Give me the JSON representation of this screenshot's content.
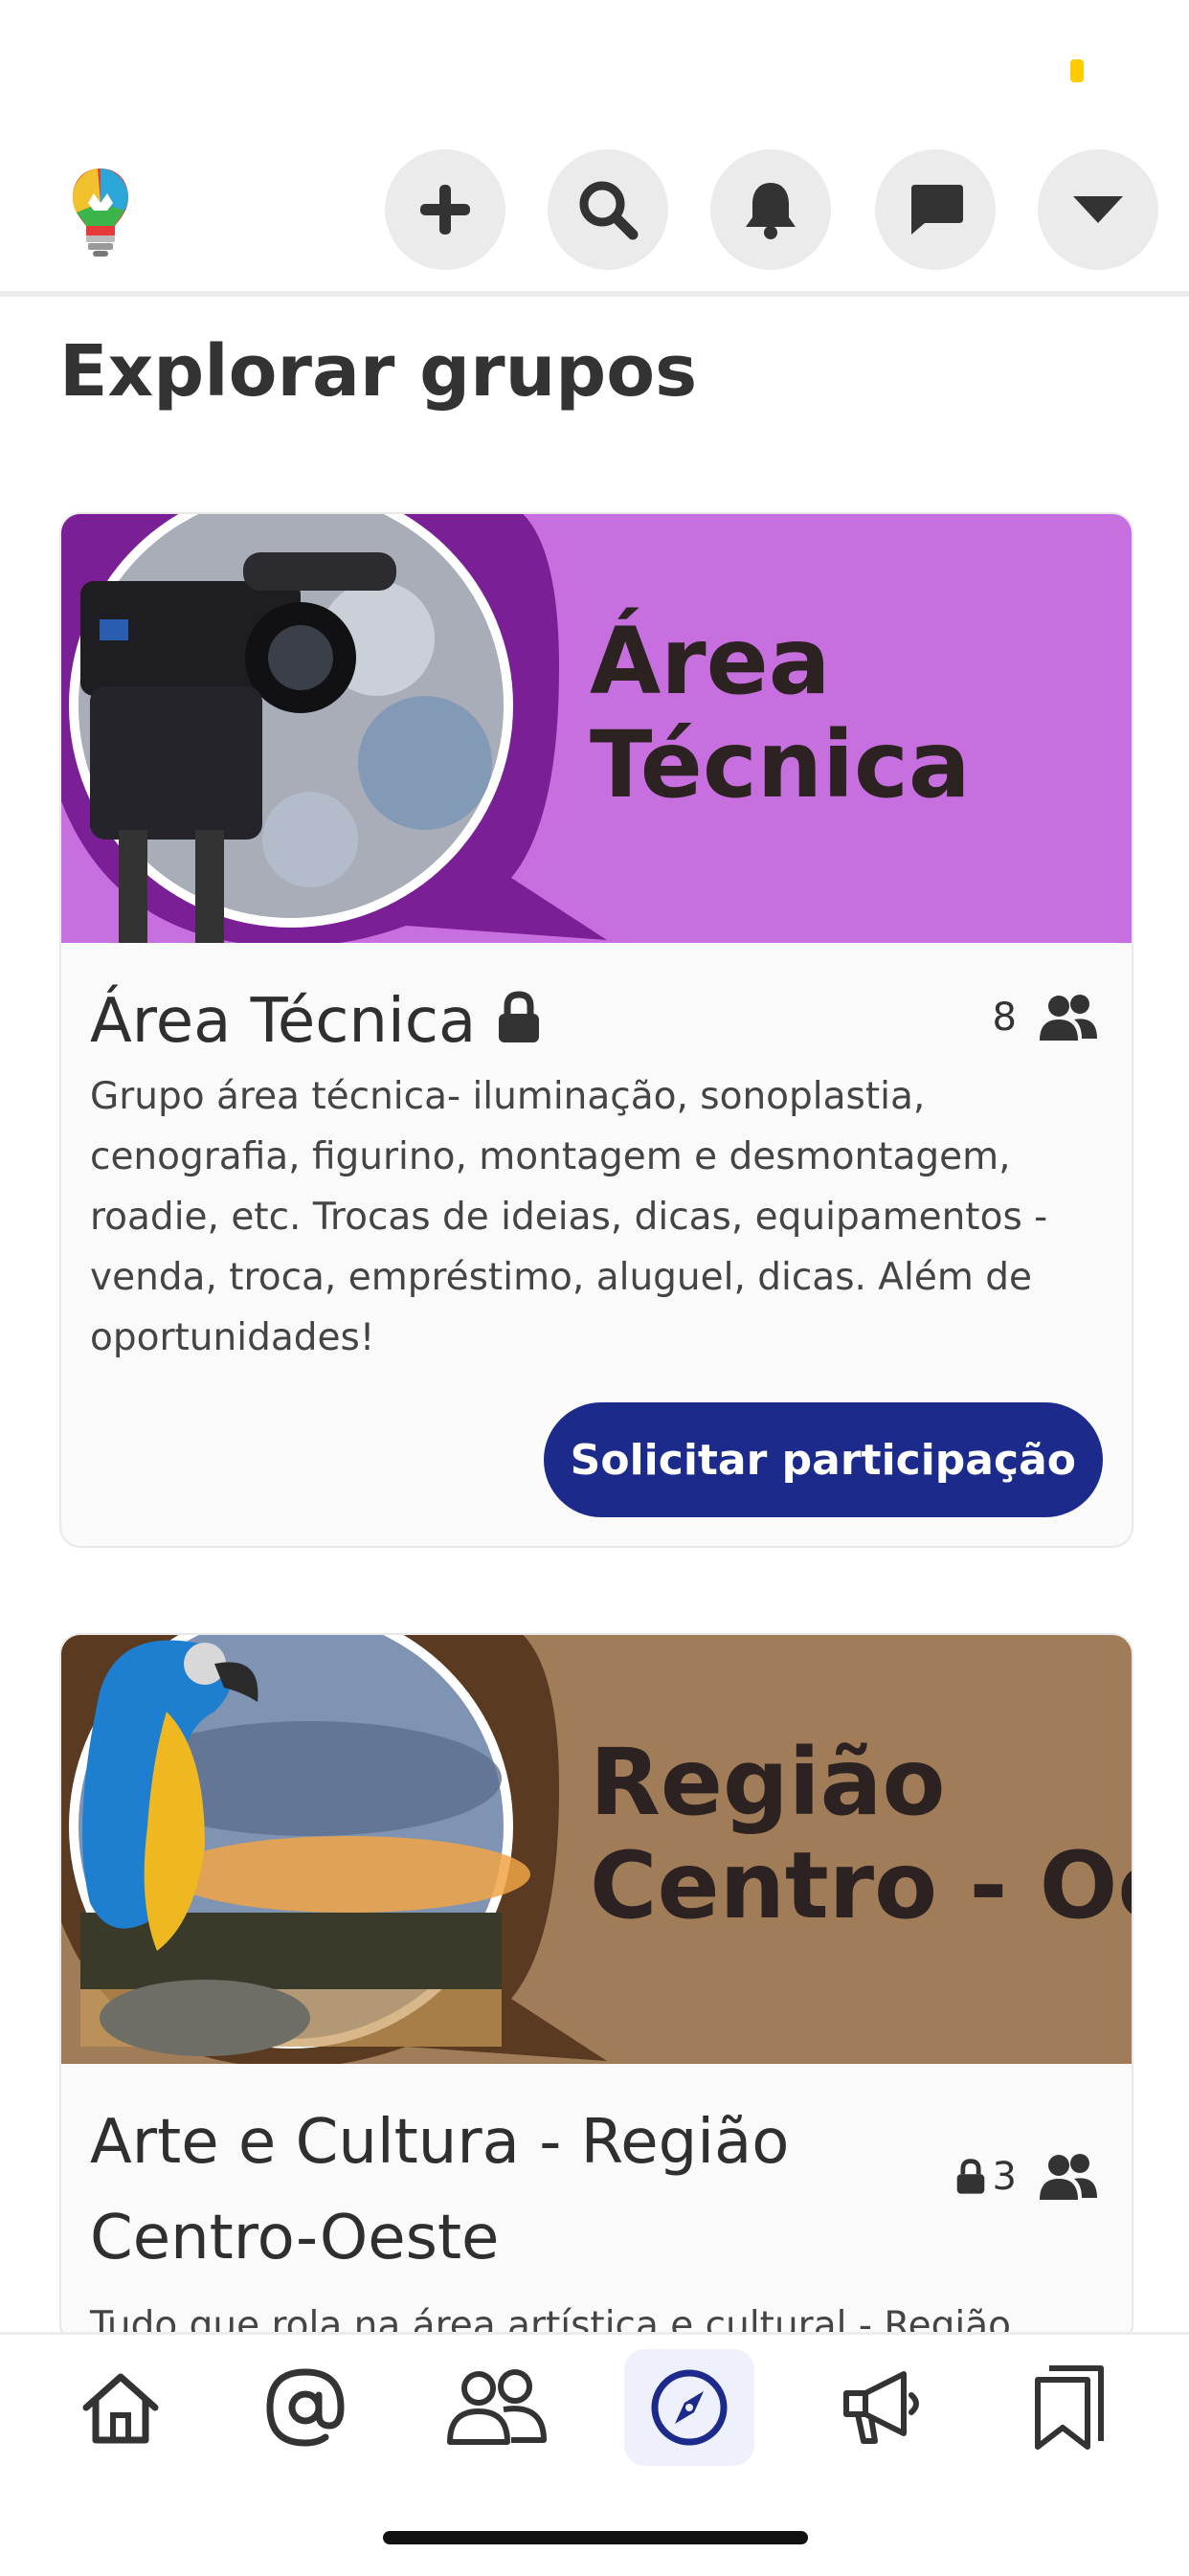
{
  "page": {
    "title": "Explorar grupos"
  },
  "colors": {
    "accent": "#1c2a8c",
    "banner1": "#c86fe0",
    "banner2": "#a07c58"
  },
  "top_nav": {
    "logo": "lightbulb-logo",
    "buttons": [
      "plus-icon",
      "search-icon",
      "bell-icon",
      "chat-icon",
      "caret-down-icon"
    ]
  },
  "groups": [
    {
      "banner_text": [
        "Área",
        "Técnica"
      ],
      "name": "Área Técnica",
      "locked": true,
      "member_count": "8",
      "description": "Grupo área técnica- iluminação, sonoplastia, cenografia, figurino, montagem e desmontagem, roadie, etc. Trocas de ideias, dicas, equipamentos - venda, troca, empréstimo, aluguel, dicas. Além de oportunidades!",
      "action_label": "Solicitar participação"
    },
    {
      "banner_text": [
        "Região",
        "Centro - Oe"
      ],
      "name": "Arte e Cultura - Região Centro-Oeste",
      "locked": true,
      "member_count": "3",
      "description": "Tudo que rola na área artística e cultural - Região"
    }
  ],
  "tab_bar": {
    "tabs": [
      "home-icon",
      "mention-icon",
      "groups-icon",
      "explore-compass-icon",
      "megaphone-icon",
      "bookmark-icon"
    ],
    "active": "explore-compass-icon"
  }
}
